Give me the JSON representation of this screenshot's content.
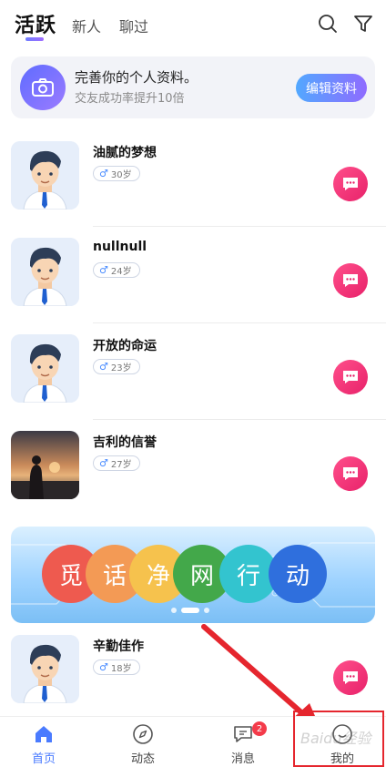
{
  "tabs": {
    "active": "活跃",
    "new": "新人",
    "chat": "聊过"
  },
  "profile_banner": {
    "title": "完善你的个人资料。",
    "subtitle": "交友成功率提升10倍",
    "button": "编辑资料"
  },
  "users": [
    {
      "name": "油腻的梦想",
      "gender_symbol": "♂",
      "age": "30岁",
      "avatar": "cartoon-man"
    },
    {
      "name": "nullnull",
      "gender_symbol": "♂",
      "age": "24岁",
      "avatar": "cartoon-man"
    },
    {
      "name": "开放的命运",
      "gender_symbol": "♂",
      "age": "23岁",
      "avatar": "cartoon-man"
    },
    {
      "name": "吉利的信誉",
      "gender_symbol": "♂",
      "age": "27岁",
      "avatar": "sunset-photo"
    },
    {
      "name": "辛勤佳作",
      "gender_symbol": "♂",
      "age": "18岁",
      "avatar": "cartoon-man"
    }
  ],
  "campaign": {
    "chars": [
      "觅",
      "话",
      "净",
      "网",
      "行",
      "动"
    ],
    "colors": [
      "#ee5a4f",
      "#f39a55",
      "#f6c24d",
      "#43a84a",
      "#33c4cf",
      "#2f6fdd"
    ]
  },
  "bottom_nav": [
    {
      "label": "首页",
      "icon": "home-icon",
      "active": true
    },
    {
      "label": "动态",
      "icon": "compass-icon",
      "active": false
    },
    {
      "label": "消息",
      "icon": "message-icon",
      "active": false,
      "badge": "2"
    },
    {
      "label": "我的",
      "icon": "profile-icon",
      "active": false
    }
  ],
  "watermark": "Baidu经验"
}
